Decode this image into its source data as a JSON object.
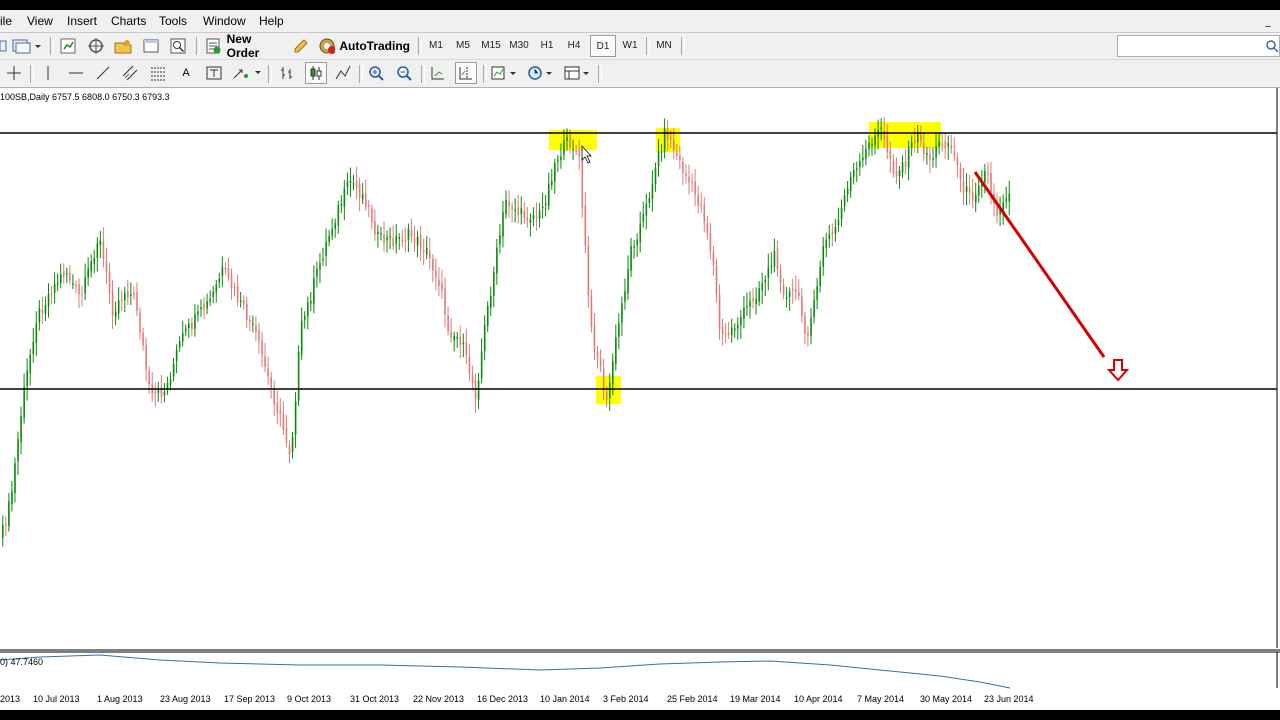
{
  "menu": [
    "ile",
    "View",
    "Insert",
    "Charts",
    "Tools",
    "Window",
    "Help"
  ],
  "toolbar": {
    "new_order": "New Order",
    "autotrading": "AutoTrading",
    "timeframes": [
      "M1",
      "M5",
      "M15",
      "M30",
      "H1",
      "H4",
      "D1",
      "W1",
      "MN"
    ],
    "active_timeframe": "D1"
  },
  "search": {
    "placeholder": ""
  },
  "chart": {
    "symbol_info": "100SB,Daily  6757.5 6808.0 6750.3 6793.3",
    "indicator_label": "0) 47.7460",
    "dates": [
      "2013",
      "10 Jul 2013",
      "1 Aug 2013",
      "23 Aug 2013",
      "17 Sep 2013",
      "9 Oct 2013",
      "31 Oct 2013",
      "22 Nov 2013",
      "16 Dec 2013",
      "10 Jan 2014",
      "3 Feb 2014",
      "25 Feb 2014",
      "19 Mar 2014",
      "10 Apr 2014",
      "7 May 2014",
      "30 May 2014",
      "23 Jun 2014"
    ],
    "colors": {
      "bull": "#0a8a0a",
      "bear": "#e07a7a",
      "highlight": "#ffff00",
      "arrow": "#d40000",
      "levels": "#000000",
      "indicator": "#3a6fa8"
    }
  },
  "chart_data": {
    "type": "candlestick",
    "levels": [
      "resistance",
      "support"
    ],
    "highlights": [
      "top-1",
      "bottom",
      "top-2",
      "top-3"
    ],
    "annotation": "down-arrow"
  }
}
